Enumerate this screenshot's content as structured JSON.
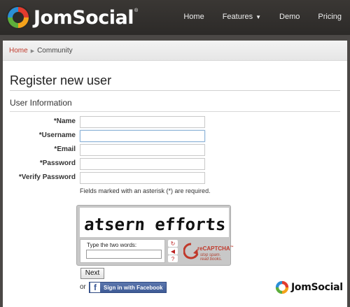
{
  "brand": {
    "name": "JomSocial",
    "reg": "®"
  },
  "nav": {
    "items": [
      "Home",
      "Features",
      "Demo",
      "Pricing"
    ],
    "caret": "▼"
  },
  "breadcrumb": {
    "home": "Home",
    "sep": "▶",
    "current": "Community"
  },
  "page": {
    "title": "Register new user",
    "section": "User Information"
  },
  "form": {
    "fields": [
      {
        "label": "*Name",
        "value": ""
      },
      {
        "label": "*Username",
        "value": ""
      },
      {
        "label": "*Email",
        "value": ""
      },
      {
        "label": "*Password",
        "value": ""
      },
      {
        "label": "*Verify Password",
        "value": ""
      }
    ],
    "note": "Fields marked with an asterisk (*) are required."
  },
  "captcha": {
    "words": "atsern efforts",
    "prompt": "Type the two words:",
    "value": "",
    "logo": "reCAPTCHA",
    "logo_prefix": "re",
    "tm": "™",
    "tagline1": "stop spam.",
    "tagline2": "read books.",
    "buttons": [
      "refresh-icon",
      "audio-icon",
      "help-icon"
    ]
  },
  "actions": {
    "next": "Next",
    "or": "or",
    "facebook": "Sign in with Facebook",
    "facebook_glyph": "f"
  },
  "footer": {
    "brand": "JomSocial"
  },
  "colors": {
    "topbar": "#2c2a28",
    "link": "#c0392b",
    "facebook": "#3b5998",
    "captcha_bg": "#c8c8c8"
  }
}
